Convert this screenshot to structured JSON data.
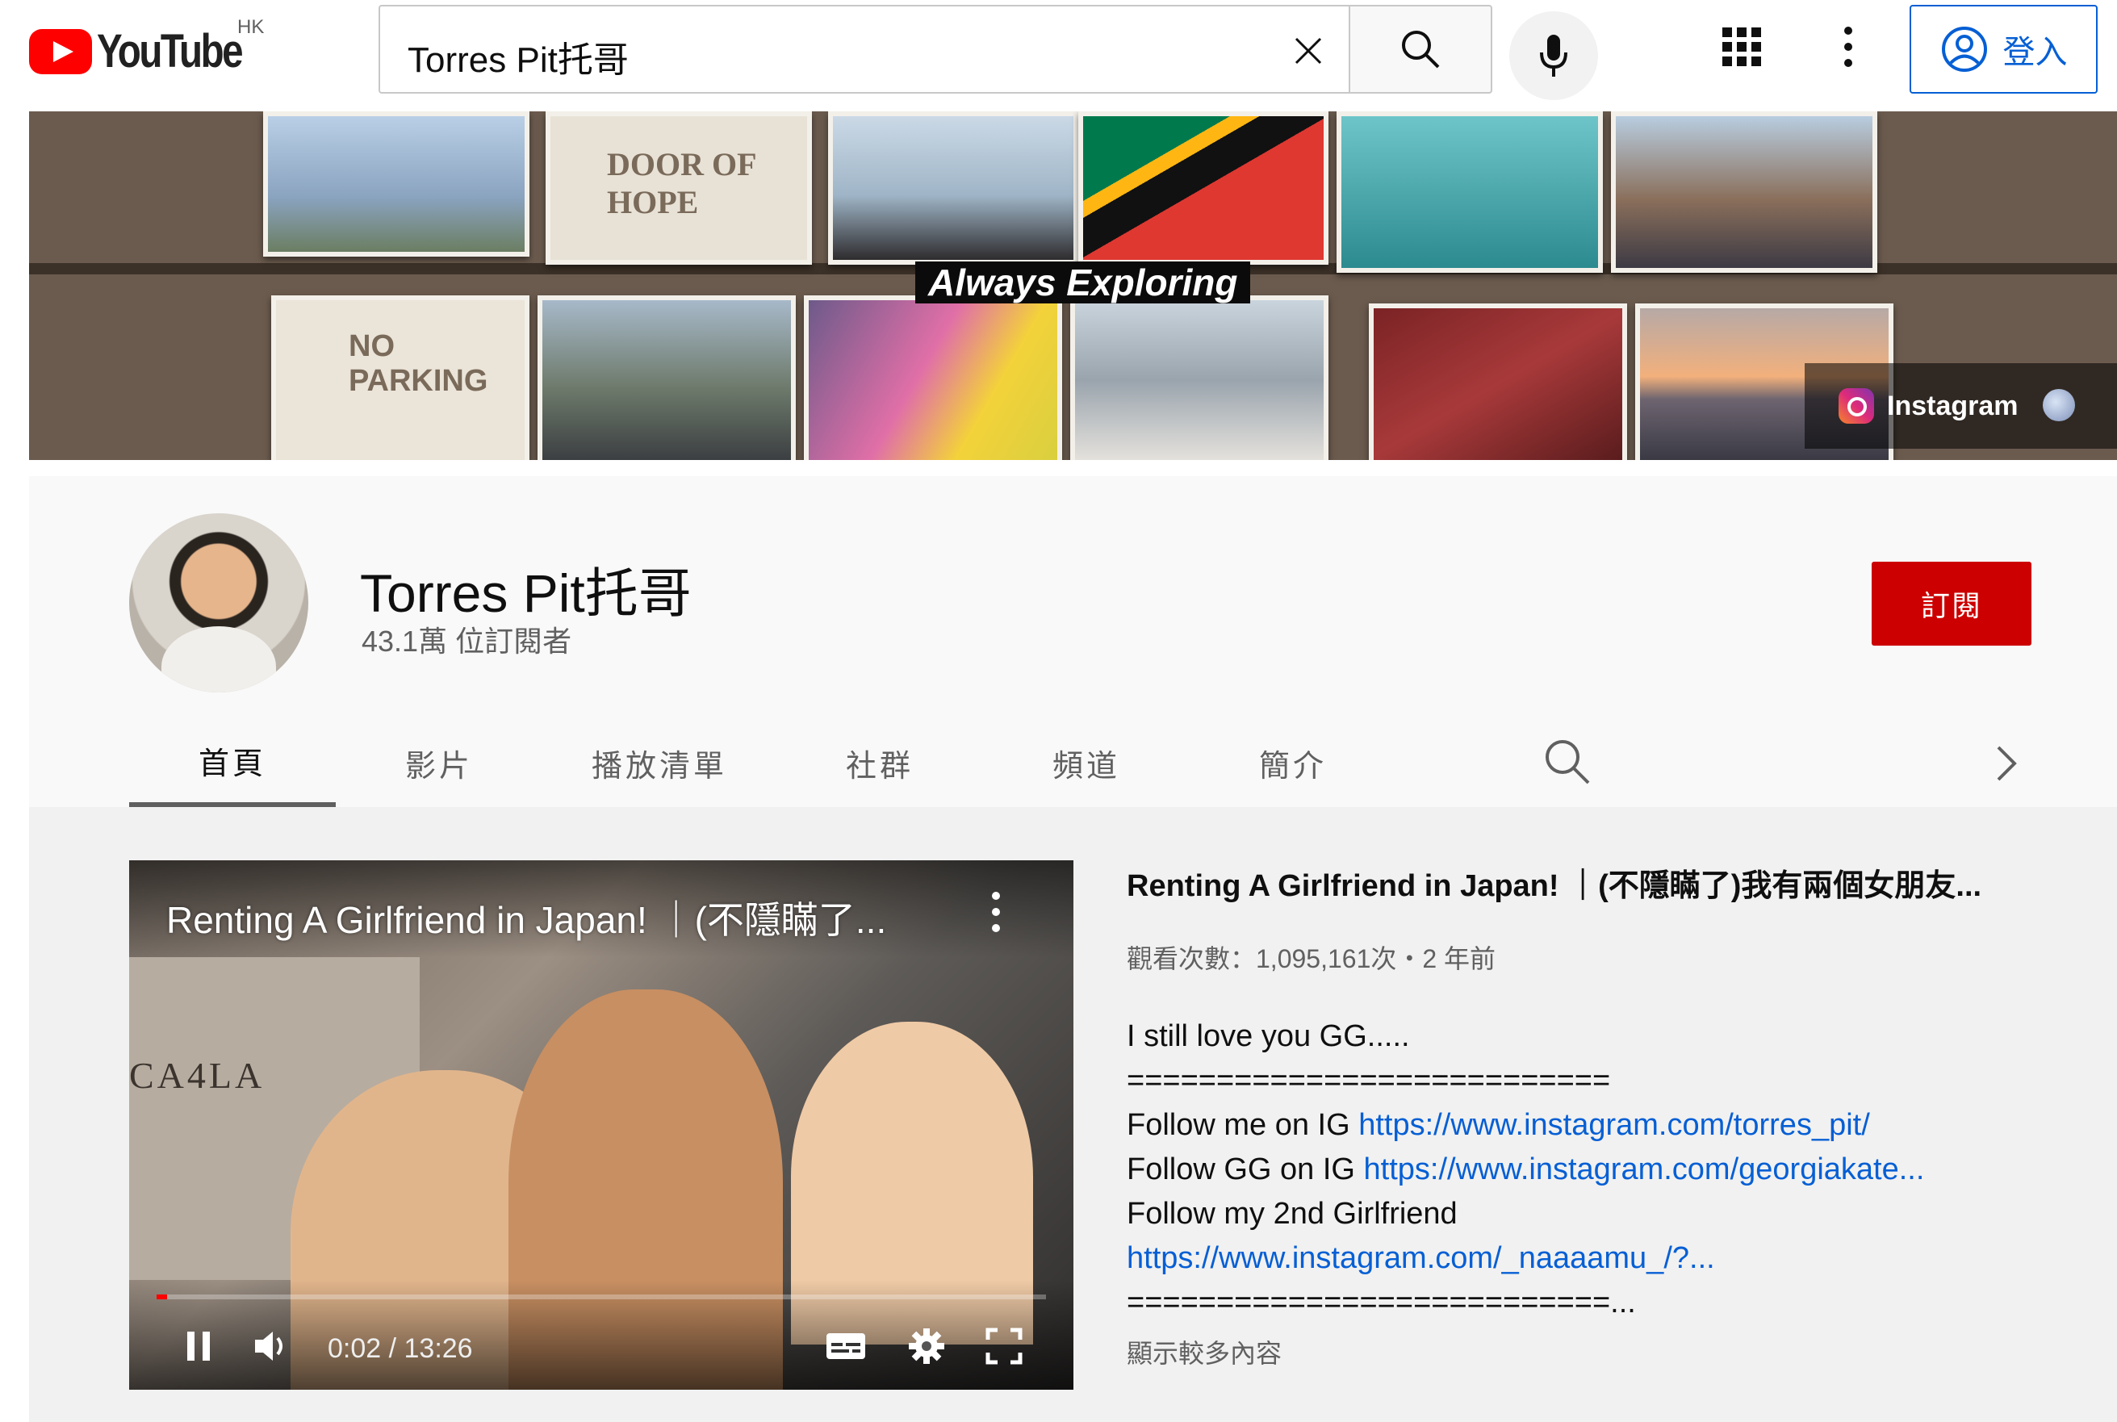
{
  "masthead": {
    "logo_text": "YouTube",
    "region": "HK",
    "search_value": "Torres Pit托哥",
    "signin_label": "登入"
  },
  "banner": {
    "tagline": "Always Exploring",
    "photo_texts": [
      "DOOR OF HOPE",
      "NO PARKING"
    ],
    "link_label": "Instagram"
  },
  "channel": {
    "name": "Torres Pit托哥",
    "subscribers": "43.1萬 位訂閱者",
    "subscribe_label": "訂閱",
    "tabs": [
      "首頁",
      "影片",
      "播放清單",
      "社群",
      "頻道",
      "簡介"
    ],
    "active_tab": "首頁"
  },
  "player": {
    "title": "Renting A Girlfriend in Japan! ｜(不隱瞞了...",
    "store_sign": "CA4LA",
    "time_display": "0:02 / 13:26",
    "progress_fraction": 0.0025
  },
  "video": {
    "title": "Renting A Girlfriend in Japan! ｜(不隱瞞了)我有兩個女朋友...",
    "meta": "觀看次數：1,095,161次・2 年前",
    "description": {
      "line1": "I still love you GG.....",
      "separator1": "===========================",
      "follow_me_prefix": "Follow me on IG ",
      "follow_me_link": "https://www.instagram.com/torres_pit/",
      "follow_gg_prefix": "Follow GG on IG ",
      "follow_gg_link": "https://www.instagram.com/georgiakate...",
      "follow_2nd": "Follow my 2nd Girlfriend",
      "follow_2nd_link": "https://www.instagram.com/_naaaamu_/?...",
      "separator2": "===========================..."
    },
    "show_more": "顯示較多內容"
  },
  "colors": {
    "brand_red": "#ff0000",
    "subscribe_red": "#cc0000",
    "link_blue": "#065fd4"
  },
  "icons": [
    "youtube-logo-icon",
    "clear-icon",
    "search-icon",
    "mic-icon",
    "apps-grid-icon",
    "more-vert-icon",
    "account-icon",
    "instagram-icon",
    "globe-icon",
    "channel-search-icon",
    "chevron-right-icon",
    "play-pause-icon",
    "volume-icon",
    "captions-icon",
    "settings-icon",
    "fullscreen-icon"
  ]
}
